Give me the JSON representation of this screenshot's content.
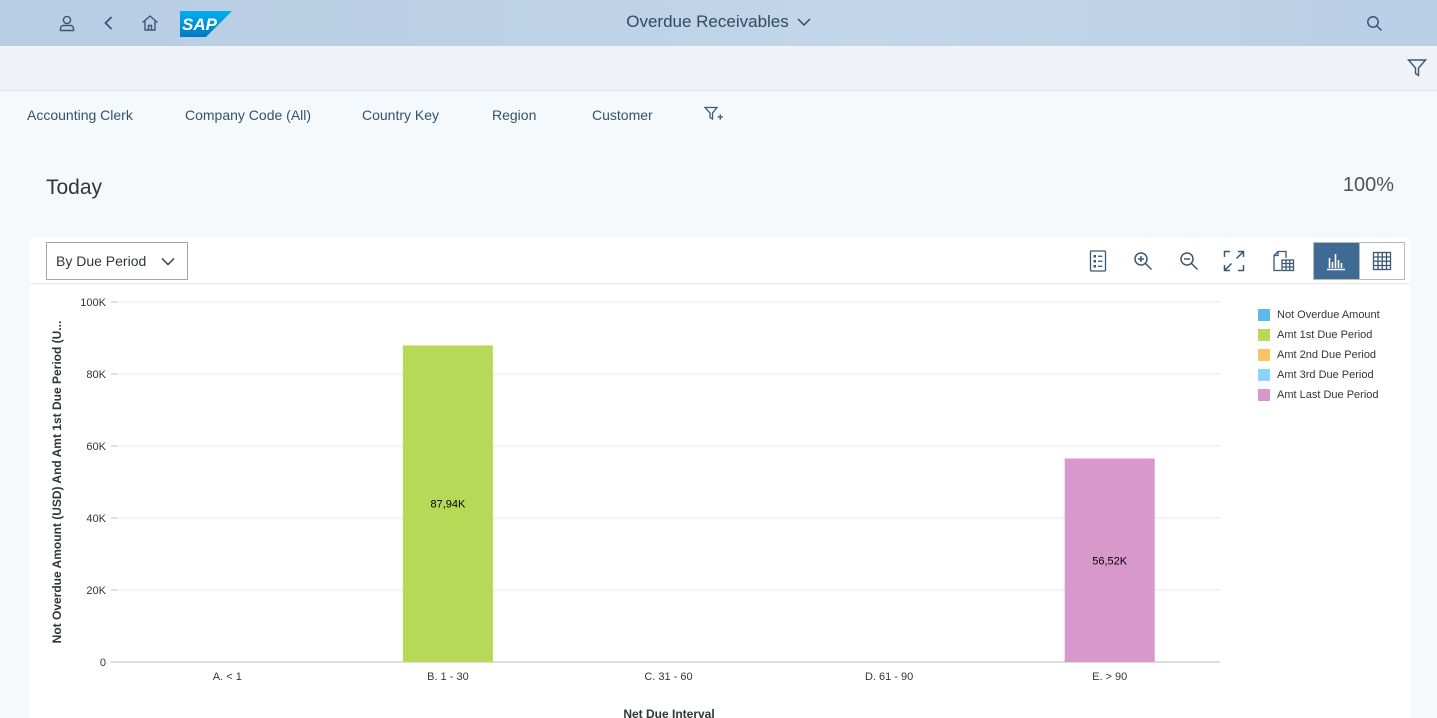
{
  "shell": {
    "title": "Overdue Receivables",
    "logo_text": "SAP",
    "icons": [
      "user-icon",
      "back-icon",
      "home-icon",
      "search-icon",
      "chevron-down-icon",
      "filter-icon"
    ]
  },
  "filter_bar": {
    "items": [
      "Accounting Clerk",
      "Company Code (All)",
      "Country Key",
      "Region",
      "Customer"
    ]
  },
  "header": {
    "title": "Today",
    "percent": "100%"
  },
  "toolbar": {
    "view_select": "By Due Period"
  },
  "chart_data": {
    "type": "bar",
    "categories": [
      "A. < 1",
      "B. 1 - 30",
      "C. 31 - 60",
      "D. 61 - 90",
      "E. > 90"
    ],
    "series": [
      {
        "name": "Not Overdue Amount",
        "color": "#5cbae6",
        "values": [
          0,
          0,
          0,
          0,
          0
        ]
      },
      {
        "name": "Amt 1st Due Period",
        "color": "#b6d957",
        "values": [
          0,
          87940,
          0,
          0,
          0
        ]
      },
      {
        "name": "Amt 2nd Due Period",
        "color": "#fac364",
        "values": [
          0,
          0,
          0,
          0,
          0
        ]
      },
      {
        "name": "Amt 3rd Due Period",
        "color": "#8cd3ff",
        "values": [
          0,
          0,
          0,
          0,
          0
        ]
      },
      {
        "name": "Amt Last Due Period",
        "color": "#d998cb",
        "values": [
          0,
          0,
          0,
          0,
          56520
        ]
      }
    ],
    "data_labels": [
      "",
      "87,94K",
      "",
      "",
      "56,52K"
    ],
    "ylim": [
      0,
      100000
    ],
    "y_ticks": [
      "0",
      "20K",
      "40K",
      "60K",
      "80K",
      "100K"
    ],
    "ylabel": "Not Overdue Amount (USD) And Amt 1st Due Period (U...",
    "xlabel": "Net Due Interval",
    "legend_position": "right",
    "grid": true
  }
}
